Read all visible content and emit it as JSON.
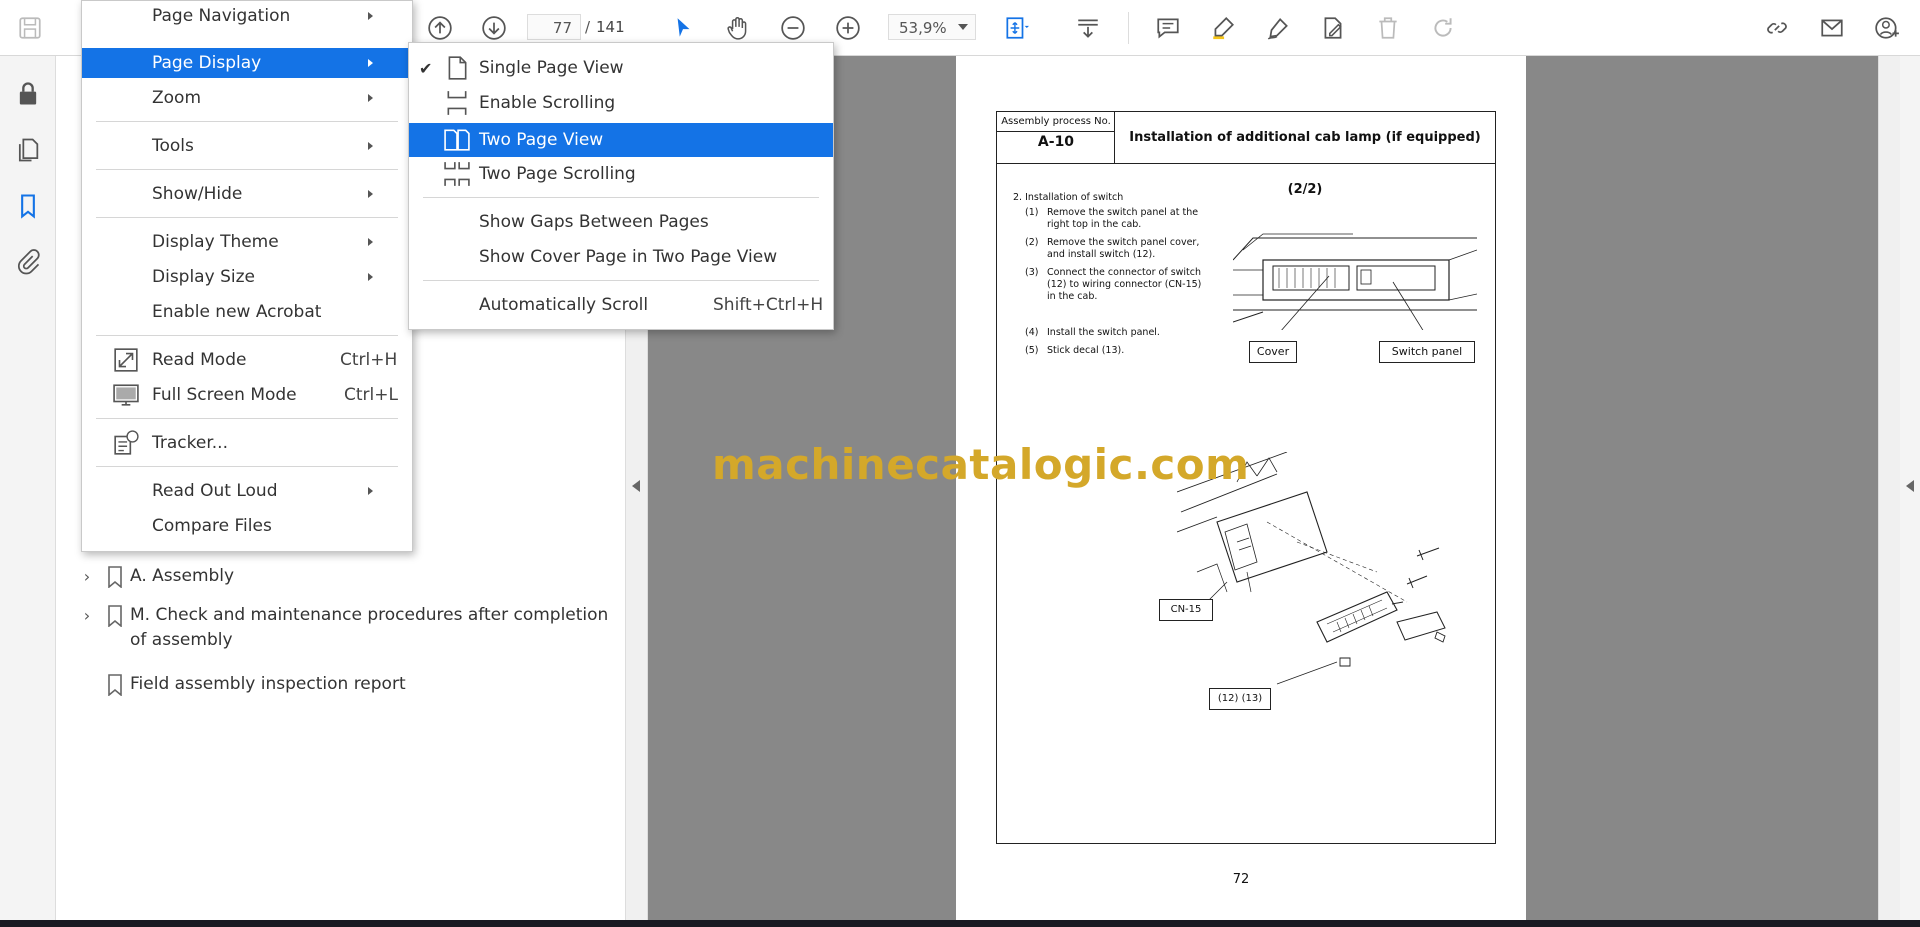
{
  "toolbar": {
    "page_current": "77",
    "page_separator": "/",
    "page_total": "141",
    "zoom": "53,9%"
  },
  "bookmarks": [
    {
      "label": "A. Assembly",
      "expandable": true
    },
    {
      "label": "M. Check and maintenance procedures after completion of assembly",
      "expandable": true
    },
    {
      "label": "Field assembly inspection report",
      "expandable": false
    }
  ],
  "view_menu": {
    "items": [
      {
        "label": "Page Navigation",
        "submenu": true
      },
      {
        "label": "Page Display",
        "submenu": true,
        "highlighted": true
      },
      {
        "label": "Zoom",
        "submenu": true
      },
      {
        "label": "Tools",
        "submenu": true
      },
      {
        "label": "Show/Hide",
        "submenu": true
      },
      {
        "label": "Display Theme",
        "submenu": true
      },
      {
        "label": "Display Size",
        "submenu": true
      },
      {
        "label": "Enable new Acrobat"
      },
      {
        "label": "Read Mode",
        "shortcut": "Ctrl+H",
        "icon": "read-mode-icon"
      },
      {
        "label": "Full Screen Mode",
        "shortcut": "Ctrl+L",
        "icon": "full-screen-icon"
      },
      {
        "label": "Tracker...",
        "icon": "tracker-icon"
      },
      {
        "label": "Read Out Loud",
        "submenu": true
      },
      {
        "label": "Compare Files"
      }
    ]
  },
  "page_display_menu": {
    "items": [
      {
        "label": "Single Page View",
        "checked": true,
        "icon": "single-page-icon"
      },
      {
        "label": "Enable Scrolling",
        "icon": "scrolling-icon"
      },
      {
        "label": "Two Page View",
        "highlighted": true,
        "icon": "two-page-icon"
      },
      {
        "label": "Two Page Scrolling",
        "icon": "two-page-scrolling-icon"
      },
      {
        "label": "Show Gaps Between Pages"
      },
      {
        "label": "Show Cover Page in Two Page View"
      },
      {
        "label": "Automatically Scroll",
        "shortcut": "Shift+Ctrl+H"
      }
    ]
  },
  "document": {
    "header_label": "Assembly process No.",
    "process_no": "A-10",
    "title": "Installation of additional cab lamp (if equipped) (2/2)",
    "section": "2. Installation of switch",
    "steps": [
      {
        "n": "(1)",
        "text": "Remove the switch panel at the right top in the cab."
      },
      {
        "n": "(2)",
        "text": "Remove the switch panel cover, and install switch (12)."
      },
      {
        "n": "(3)",
        "text": "Connect the connector of switch (12) to wiring connector (CN-15) in the cab."
      },
      {
        "n": "(4)",
        "text": "Install the switch panel."
      },
      {
        "n": "(5)",
        "text": "Stick decal (13)."
      }
    ],
    "callouts": {
      "cover": "Cover",
      "switch_panel": "Switch panel",
      "cn15": "CN-15",
      "parts": "(12) (13)"
    },
    "page_number": "72"
  },
  "watermark": "machinecatalogic.com",
  "colors": {
    "accent": "#1473e6",
    "watermark": "#d4a82a"
  }
}
